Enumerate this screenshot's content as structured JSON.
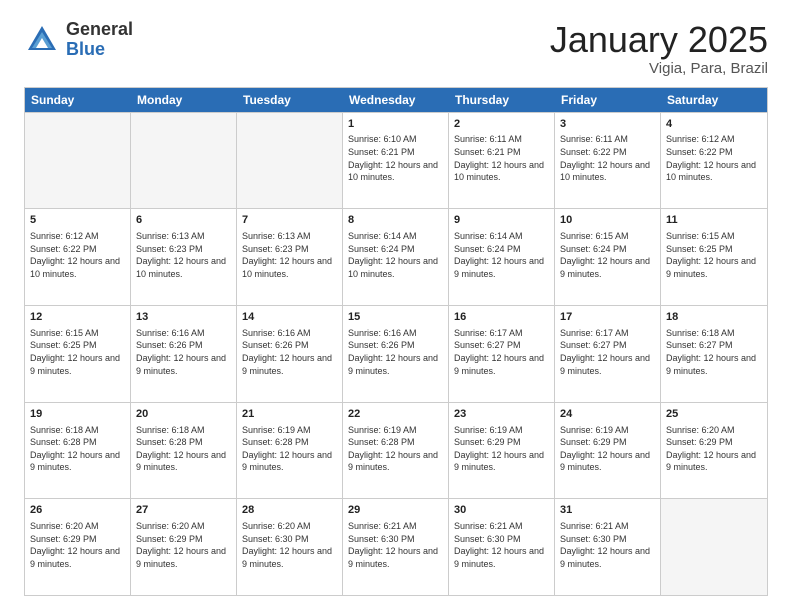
{
  "header": {
    "logo_general": "General",
    "logo_blue": "Blue",
    "month_title": "January 2025",
    "location": "Vigia, Para, Brazil"
  },
  "days_of_week": [
    "Sunday",
    "Monday",
    "Tuesday",
    "Wednesday",
    "Thursday",
    "Friday",
    "Saturday"
  ],
  "weeks": [
    [
      {
        "day": "",
        "text": ""
      },
      {
        "day": "",
        "text": ""
      },
      {
        "day": "",
        "text": ""
      },
      {
        "day": "1",
        "text": "Sunrise: 6:10 AM\nSunset: 6:21 PM\nDaylight: 12 hours and 10 minutes."
      },
      {
        "day": "2",
        "text": "Sunrise: 6:11 AM\nSunset: 6:21 PM\nDaylight: 12 hours and 10 minutes."
      },
      {
        "day": "3",
        "text": "Sunrise: 6:11 AM\nSunset: 6:22 PM\nDaylight: 12 hours and 10 minutes."
      },
      {
        "day": "4",
        "text": "Sunrise: 6:12 AM\nSunset: 6:22 PM\nDaylight: 12 hours and 10 minutes."
      }
    ],
    [
      {
        "day": "5",
        "text": "Sunrise: 6:12 AM\nSunset: 6:22 PM\nDaylight: 12 hours and 10 minutes."
      },
      {
        "day": "6",
        "text": "Sunrise: 6:13 AM\nSunset: 6:23 PM\nDaylight: 12 hours and 10 minutes."
      },
      {
        "day": "7",
        "text": "Sunrise: 6:13 AM\nSunset: 6:23 PM\nDaylight: 12 hours and 10 minutes."
      },
      {
        "day": "8",
        "text": "Sunrise: 6:14 AM\nSunset: 6:24 PM\nDaylight: 12 hours and 10 minutes."
      },
      {
        "day": "9",
        "text": "Sunrise: 6:14 AM\nSunset: 6:24 PM\nDaylight: 12 hours and 9 minutes."
      },
      {
        "day": "10",
        "text": "Sunrise: 6:15 AM\nSunset: 6:24 PM\nDaylight: 12 hours and 9 minutes."
      },
      {
        "day": "11",
        "text": "Sunrise: 6:15 AM\nSunset: 6:25 PM\nDaylight: 12 hours and 9 minutes."
      }
    ],
    [
      {
        "day": "12",
        "text": "Sunrise: 6:15 AM\nSunset: 6:25 PM\nDaylight: 12 hours and 9 minutes."
      },
      {
        "day": "13",
        "text": "Sunrise: 6:16 AM\nSunset: 6:26 PM\nDaylight: 12 hours and 9 minutes."
      },
      {
        "day": "14",
        "text": "Sunrise: 6:16 AM\nSunset: 6:26 PM\nDaylight: 12 hours and 9 minutes."
      },
      {
        "day": "15",
        "text": "Sunrise: 6:16 AM\nSunset: 6:26 PM\nDaylight: 12 hours and 9 minutes."
      },
      {
        "day": "16",
        "text": "Sunrise: 6:17 AM\nSunset: 6:27 PM\nDaylight: 12 hours and 9 minutes."
      },
      {
        "day": "17",
        "text": "Sunrise: 6:17 AM\nSunset: 6:27 PM\nDaylight: 12 hours and 9 minutes."
      },
      {
        "day": "18",
        "text": "Sunrise: 6:18 AM\nSunset: 6:27 PM\nDaylight: 12 hours and 9 minutes."
      }
    ],
    [
      {
        "day": "19",
        "text": "Sunrise: 6:18 AM\nSunset: 6:28 PM\nDaylight: 12 hours and 9 minutes."
      },
      {
        "day": "20",
        "text": "Sunrise: 6:18 AM\nSunset: 6:28 PM\nDaylight: 12 hours and 9 minutes."
      },
      {
        "day": "21",
        "text": "Sunrise: 6:19 AM\nSunset: 6:28 PM\nDaylight: 12 hours and 9 minutes."
      },
      {
        "day": "22",
        "text": "Sunrise: 6:19 AM\nSunset: 6:28 PM\nDaylight: 12 hours and 9 minutes."
      },
      {
        "day": "23",
        "text": "Sunrise: 6:19 AM\nSunset: 6:29 PM\nDaylight: 12 hours and 9 minutes."
      },
      {
        "day": "24",
        "text": "Sunrise: 6:19 AM\nSunset: 6:29 PM\nDaylight: 12 hours and 9 minutes."
      },
      {
        "day": "25",
        "text": "Sunrise: 6:20 AM\nSunset: 6:29 PM\nDaylight: 12 hours and 9 minutes."
      }
    ],
    [
      {
        "day": "26",
        "text": "Sunrise: 6:20 AM\nSunset: 6:29 PM\nDaylight: 12 hours and 9 minutes."
      },
      {
        "day": "27",
        "text": "Sunrise: 6:20 AM\nSunset: 6:29 PM\nDaylight: 12 hours and 9 minutes."
      },
      {
        "day": "28",
        "text": "Sunrise: 6:20 AM\nSunset: 6:30 PM\nDaylight: 12 hours and 9 minutes."
      },
      {
        "day": "29",
        "text": "Sunrise: 6:21 AM\nSunset: 6:30 PM\nDaylight: 12 hours and 9 minutes."
      },
      {
        "day": "30",
        "text": "Sunrise: 6:21 AM\nSunset: 6:30 PM\nDaylight: 12 hours and 9 minutes."
      },
      {
        "day": "31",
        "text": "Sunrise: 6:21 AM\nSunset: 6:30 PM\nDaylight: 12 hours and 9 minutes."
      },
      {
        "day": "",
        "text": ""
      }
    ]
  ]
}
